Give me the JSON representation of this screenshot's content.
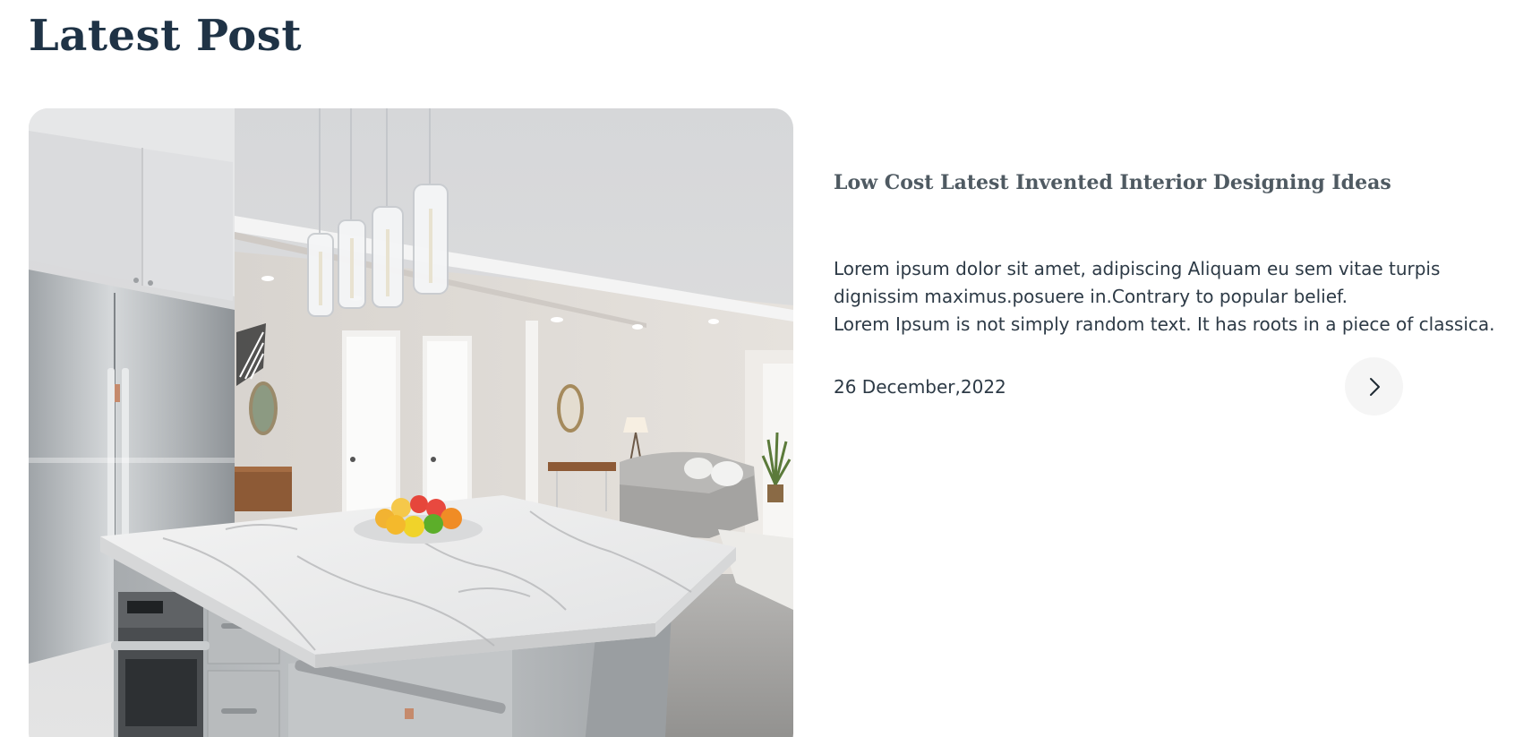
{
  "section": {
    "title": "Latest Post"
  },
  "post": {
    "image_alt": "Bright modern kitchen with marble island, pendant lights and living room",
    "title": "Low Cost Latest Invented Interior Designing Ideas",
    "excerpt_lines": [
      "Lorem ipsum dolor sit amet, adipiscing Aliquam eu sem vitae turpis",
      "dignissim maximus.posuere in.Contrary to popular belief.",
      "Lorem Ipsum is not simply random text. It has roots in a piece of classica."
    ],
    "date": "26 December,2022",
    "read_more_icon": "chevron-right-icon"
  },
  "colors": {
    "heading": "#1f3346",
    "post_title": "#4f5a62",
    "body_text": "#2d3a46",
    "button_bg": "#f5f5f5"
  }
}
